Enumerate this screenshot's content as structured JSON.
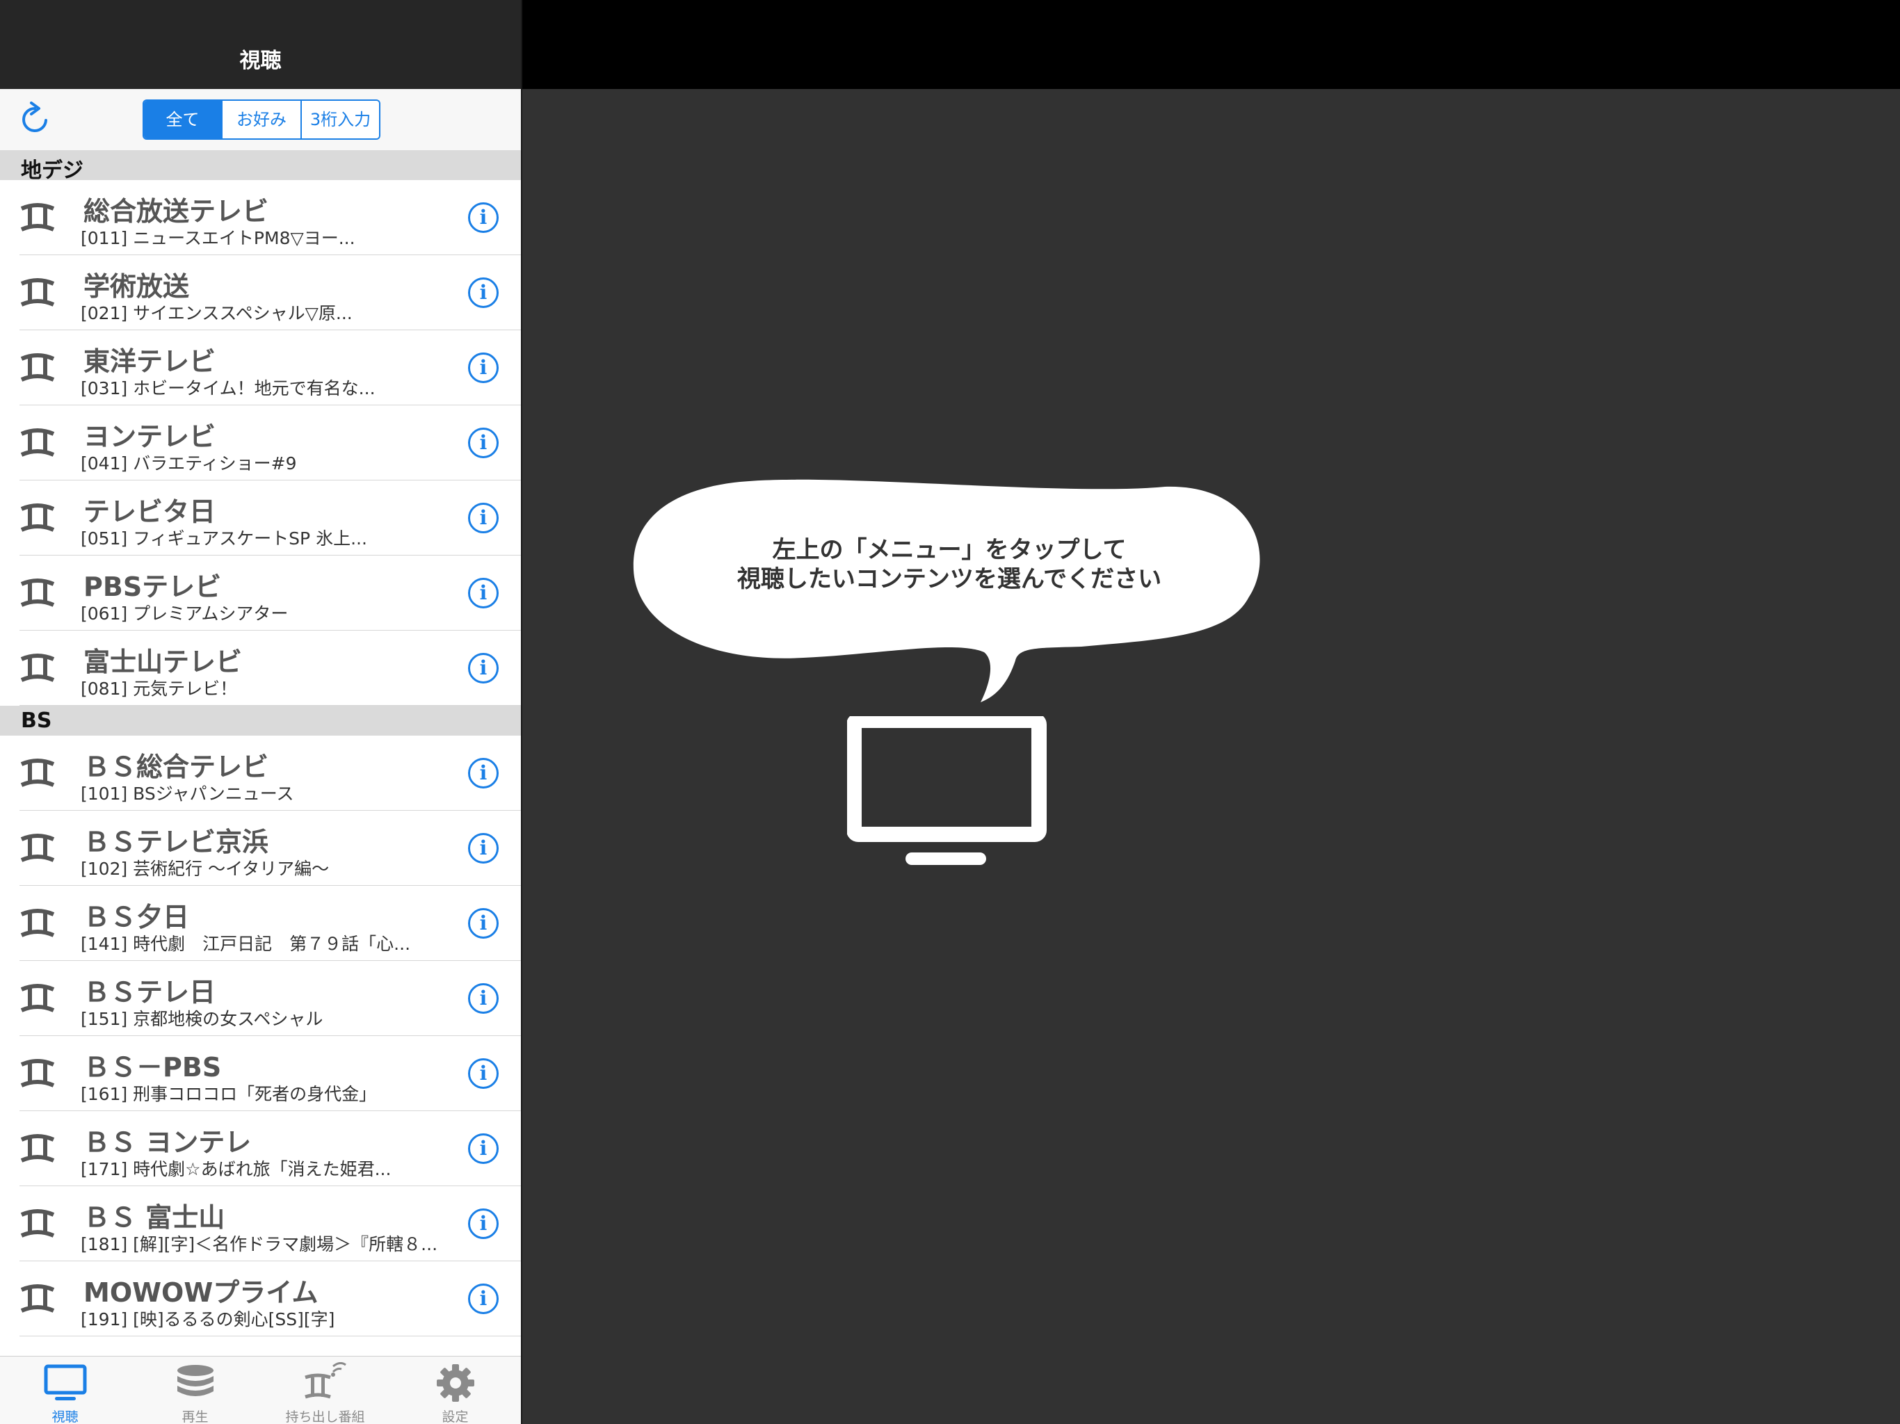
{
  "nav": {
    "title": "視聴"
  },
  "toolbar": {
    "segments": [
      {
        "label": "全て",
        "active": true
      },
      {
        "label": "お好み",
        "active": false
      },
      {
        "label": "3桁入力",
        "active": false
      }
    ]
  },
  "sections": [
    {
      "title": "地デジ",
      "channels": [
        {
          "name": "総合放送テレビ",
          "program": "[011] ニュースエイトPM8▽ヨー..."
        },
        {
          "name": "学術放送",
          "program": "[021] サイエンススペシャル▽原..."
        },
        {
          "name": "東洋テレビ",
          "program": "[031] ホビータイム！地元で有名な..."
        },
        {
          "name": "ヨンテレビ",
          "program": "[041] バラエティショー#9"
        },
        {
          "name": "テレビタ日",
          "program": "[051] フィギュアスケートSP 氷上..."
        },
        {
          "name": "PBSテレビ",
          "program": "[061] プレミアムシアター"
        },
        {
          "name": "富士山テレビ",
          "program": "[081] 元気テレビ！"
        }
      ]
    },
    {
      "title": "BS",
      "channels": [
        {
          "name": "ＢＳ総合テレビ",
          "program": "[101] BSジャパンニュース"
        },
        {
          "name": "ＢＳテレビ京浜",
          "program": "[102] 芸術紀行 〜イタリア編〜"
        },
        {
          "name": "ＢＳ夕日",
          "program": "[141] 時代劇　江戸日記　第７９話「心..."
        },
        {
          "name": "ＢＳテレ日",
          "program": "[151] 京都地検の女スペシャル"
        },
        {
          "name": "ＢＳ－PBS",
          "program": "[161] 刑事コロコロ「死者の身代金」"
        },
        {
          "name": "ＢＳ ヨンテレ",
          "program": "[171] 時代劇☆あばれ旅「消えた姫君..."
        },
        {
          "name": "ＢＳ 富士山",
          "program": "[181] [解][字]＜名作ドラマ劇場＞『所轄８..."
        },
        {
          "name": "MOWOWプライム",
          "program": "[191] [映]るるるの剣心[SS][字]"
        }
      ]
    }
  ],
  "tabbar": {
    "tabs": [
      {
        "label": "視聴",
        "icon": "tv-icon",
        "active": true
      },
      {
        "label": "再生",
        "icon": "disc-stack-icon",
        "active": false
      },
      {
        "label": "持ち出し番組",
        "icon": "antenna-signal-icon",
        "active": false
      },
      {
        "label": "設定",
        "icon": "gear-icon",
        "active": false
      }
    ]
  },
  "detail": {
    "message_line1": "左上の「メニュー」をタップして",
    "message_line2": "視聴したいコンテンツを選んでください"
  },
  "colors": {
    "accent": "#1a7fe6",
    "navbar": "#262626",
    "detail_bg": "#323232",
    "section_bg": "#dadada"
  }
}
